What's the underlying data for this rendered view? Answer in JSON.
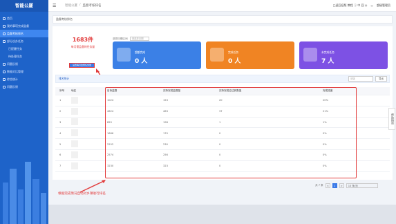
{
  "app": {
    "title": "智能公厦"
  },
  "sidebar": {
    "items": [
      {
        "label": "首页"
      },
      {
        "label": "我的事项完成监督"
      },
      {
        "label": "监督考核排名"
      },
      {
        "label": "部分议办任务"
      },
      {
        "label": "已提醒任务"
      },
      {
        "label": "待处理任务"
      },
      {
        "label": "问题反馈"
      },
      {
        "label": "数据对比管理"
      },
      {
        "label": "综合统计"
      },
      {
        "label": "问题反馈"
      }
    ]
  },
  "topbar": {
    "breadcrumb_1": "智能公厦",
    "separator": "/",
    "breadcrumb_2": "监督考核排名",
    "right_text": "□返回旧版 教程 ⓘ 中 回 ◎",
    "user": "超级管理员"
  },
  "tab": {
    "label": "监督考核排名"
  },
  "summary": {
    "count": "1683件",
    "label": "每月需监督的任务量"
  },
  "filter_button": "设置每月监督任务量",
  "date_filter": {
    "label": "选择日期区间",
    "placeholder": "请选择日期"
  },
  "cards": [
    {
      "title": "超额完成",
      "value": "0 人"
    },
    {
      "title": "完成任务",
      "value": "0 人"
    },
    {
      "title": "未完成任务",
      "value": "7 人"
    }
  ],
  "annotations": {
    "top": "设置每月乡镇和社区应完成的周问事项监督量",
    "bottom": "根据完成情况自动对乡镇进行排名"
  },
  "table_header": {
    "title": "排名统计",
    "search_placeholder": "请选",
    "search_button": "导出"
  },
  "table": {
    "columns": [
      "序号",
      "地区",
      "目标监督",
      "实际完成监督量",
      "实际完成应达到数量",
      "完成进度"
    ],
    "rows": [
      [
        "1",
        "",
        "1024",
        "153",
        "20",
        "20%"
      ],
      [
        "2",
        "",
        "4624",
        "463",
        "37",
        "21%"
      ],
      [
        "3",
        "",
        "855",
        "198",
        "1",
        "1%"
      ],
      [
        "4",
        "",
        "1666",
        "170",
        "0",
        "0%"
      ],
      [
        "5",
        "",
        "2252",
        "230",
        "0",
        "0%"
      ],
      [
        "6",
        "",
        "2574",
        "256",
        "0",
        "0%"
      ],
      [
        "7",
        "",
        "3230",
        "323",
        "0",
        "0%"
      ]
    ]
  },
  "pagination": {
    "total": "共 7 条",
    "page": "1",
    "per_page": "10 条/页",
    "prev": "<",
    "next": ">"
  },
  "help": {
    "label": "帮助指南"
  }
}
